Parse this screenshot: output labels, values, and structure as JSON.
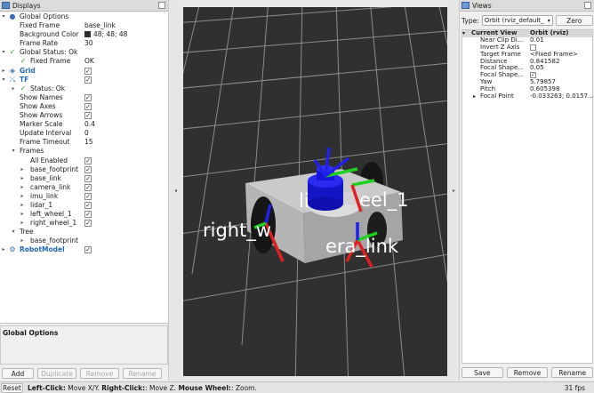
{
  "displays": {
    "title": "Displays",
    "rows": [
      {
        "label": "Global Options",
        "value": ""
      },
      {
        "label": "Fixed Frame",
        "value": "base_link"
      },
      {
        "label": "Background Color",
        "value": "48; 48; 48"
      },
      {
        "label": "Frame Rate",
        "value": "30"
      },
      {
        "label": "Global Status: Ok",
        "value": ""
      },
      {
        "label": "Fixed Frame",
        "value": "OK"
      },
      {
        "label": "Grid",
        "value": "✓"
      },
      {
        "label": "TF",
        "value": "✓"
      },
      {
        "label": "Status: Ok",
        "value": ""
      },
      {
        "label": "Show Names",
        "value": "✓"
      },
      {
        "label": "Show Axes",
        "value": "✓"
      },
      {
        "label": "Show Arrows",
        "value": "✓"
      },
      {
        "label": "Marker Scale",
        "value": "0.4"
      },
      {
        "label": "Update Interval",
        "value": "0"
      },
      {
        "label": "Frame Timeout",
        "value": "15"
      },
      {
        "label": "Frames",
        "value": ""
      },
      {
        "label": "All Enabled",
        "value": "✓"
      },
      {
        "label": "base_footprint",
        "value": "✓"
      },
      {
        "label": "base_link",
        "value": "✓"
      },
      {
        "label": "camera_link",
        "value": "✓"
      },
      {
        "label": "imu_link",
        "value": "✓"
      },
      {
        "label": "lidar_1",
        "value": "✓"
      },
      {
        "label": "left_wheel_1",
        "value": "✓"
      },
      {
        "label": "right_wheel_1",
        "value": "✓"
      },
      {
        "label": "Tree",
        "value": ""
      },
      {
        "label": "base_footprint",
        "value": ""
      },
      {
        "label": "RobotModel",
        "value": "✓"
      }
    ],
    "description_title": "Global Options",
    "buttons": {
      "add": "Add",
      "duplicate": "Duplicate",
      "remove": "Remove",
      "rename": "Rename"
    }
  },
  "viewport": {
    "labels": {
      "right_wheel": "right_w",
      "lidar": "li",
      "left_wheel": "eel_1",
      "camera": "era_link"
    },
    "colors": {
      "background": "#303030",
      "grid": "#8a8a8a",
      "chassis": "#c9c9c9",
      "lidar": "#1515d8",
      "axis_x": "#e02020",
      "axis_y": "#20d020",
      "axis_z": "#2020e8"
    }
  },
  "views": {
    "title": "Views",
    "type_label": "Type:",
    "type_value": "Orbit (rviz_default_",
    "zero_label": "Zero",
    "head": {
      "label": "Current View",
      "value": "Orbit (rviz)"
    },
    "rows": [
      {
        "label": "Near Clip Di...",
        "value": "0.01"
      },
      {
        "label": "Invert Z Axis",
        "value": ""
      },
      {
        "label": "Target Frame",
        "value": "<Fixed Frame>"
      },
      {
        "label": "Distance",
        "value": "0.841582"
      },
      {
        "label": "Focal Shape...",
        "value": "0.05"
      },
      {
        "label": "Focal Shape...",
        "value": "✓"
      },
      {
        "label": "Yaw",
        "value": "5.79857"
      },
      {
        "label": "Pitch",
        "value": "0.605398"
      },
      {
        "label": "Focal Point",
        "value": "-0.033263; 0.0157..."
      }
    ],
    "buttons": {
      "save": "Save",
      "remove": "Remove",
      "rename": "Rename"
    }
  },
  "status": {
    "reset": "Reset",
    "hint_left_b": "Left-Click:",
    "hint_left": " Move X/Y. ",
    "hint_right_b": "Right-Click:",
    "hint_right": ": Move Z. ",
    "hint_wheel_b": "Mouse Wheel:",
    "hint_wheel": ": Zoom.",
    "fps": "31 fps"
  }
}
